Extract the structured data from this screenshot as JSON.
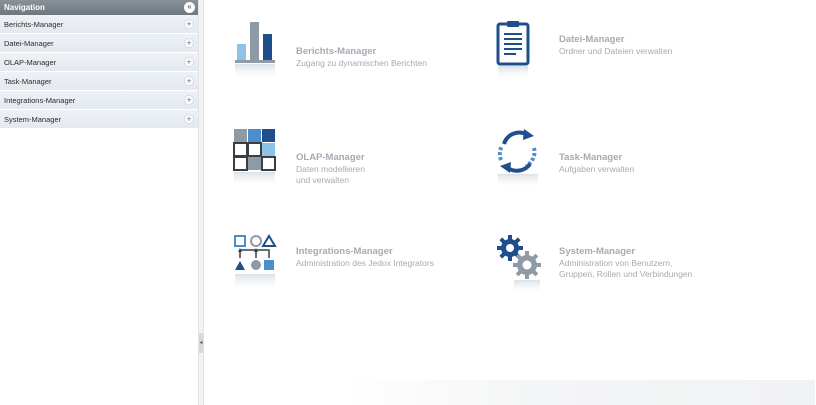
{
  "navigation": {
    "title": "Navigation",
    "collapse_symbol": "«",
    "items": [
      {
        "label": "Berichts-Manager",
        "expand": "+"
      },
      {
        "label": "Datei-Manager",
        "expand": "+"
      },
      {
        "label": "OLAP-Manager",
        "expand": "+"
      },
      {
        "label": "Task-Manager",
        "expand": "+"
      },
      {
        "label": "Integrations-Manager",
        "expand": "+"
      },
      {
        "label": "System-Manager",
        "expand": "+"
      }
    ]
  },
  "splitter": {
    "arrow": "◂"
  },
  "tiles": [
    {
      "title": "Berichts-Manager",
      "desc_line1": "Zugang zu dynamischen Berichten",
      "desc_line2": "",
      "icon": "bar-chart-icon"
    },
    {
      "title": "Datei-Manager",
      "desc_line1": "Ordner und Dateien verwalten",
      "desc_line2": "",
      "icon": "clipboard-document-icon"
    },
    {
      "title": "OLAP-Manager",
      "desc_line1": "Daten modellieren",
      "desc_line2": "und verwalten",
      "icon": "data-grid-icon"
    },
    {
      "title": "Task-Manager",
      "desc_line1": "Aufgaben verwalten",
      "desc_line2": "",
      "icon": "refresh-cycle-icon"
    },
    {
      "title": "Integrations-Manager",
      "desc_line1": "Administration des Jedox Integrators",
      "desc_line2": "",
      "icon": "shapes-flow-icon"
    },
    {
      "title": "System-Manager",
      "desc_line1": "Administration von Benutzern,",
      "desc_line2": "Gruppen, Rollen und Verbindungen",
      "icon": "gears-icon"
    }
  ],
  "colors": {
    "dark_blue": "#1f4e8c",
    "mid_blue": "#4a8fcc",
    "light_blue": "#8ec2e6",
    "gray": "#8e9aa6",
    "text_gray": "#a4abb2"
  }
}
